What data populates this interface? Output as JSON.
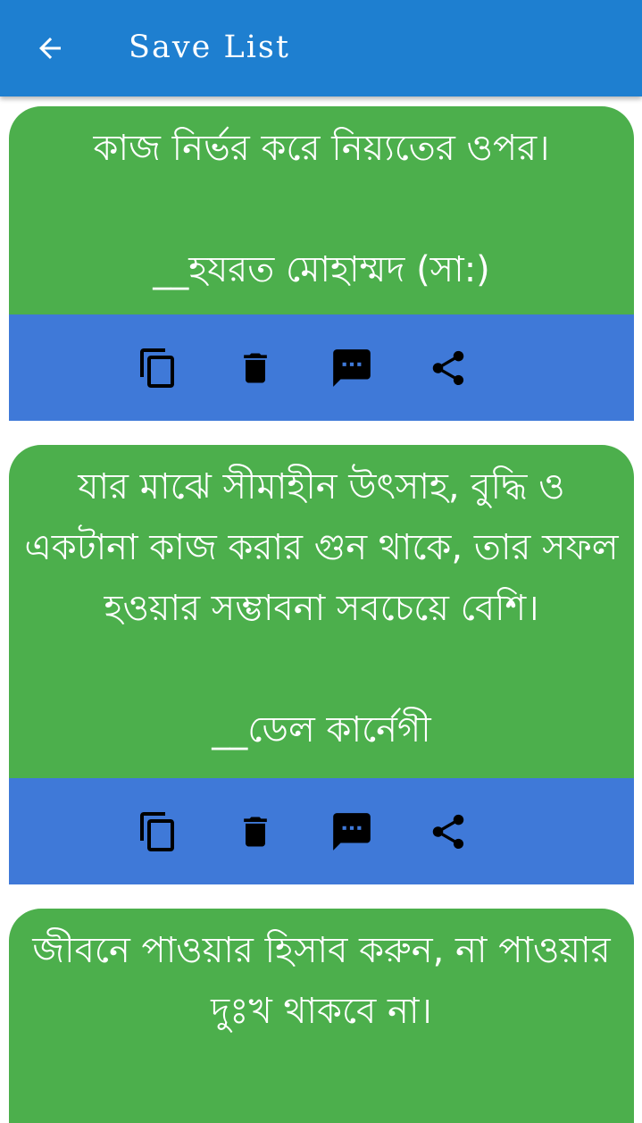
{
  "app_bar": {
    "title": "Save List",
    "back_icon": "arrow-back-icon",
    "color": "#1e7fd0"
  },
  "colors": {
    "card_background": "#4caf4c",
    "action_bar": "#3f79d8",
    "text": "#ffffff",
    "icon": "#000000"
  },
  "quotes": [
    {
      "text": "কাজ নির্ভর করে নিয়্যতের ওপর।",
      "author": "__হযরত মোহাম্মদ (সা:)"
    },
    {
      "text": "যার মাঝে সীমাহীন উৎসাহ, বুদ্ধি ও একটানা কাজ করার গুন থাকে, তার সফল হওয়ার সম্ভাবনা সবচেয়ে বেশি।",
      "author": "__ডেল কার্নেগী"
    },
    {
      "text": "জীবনে পাওয়ার হিসাব করুন, না পাওয়ার দুঃখ থাকবে না।",
      "author": ""
    }
  ],
  "action_icons": [
    "copy-icon",
    "delete-icon",
    "message-icon",
    "share-icon"
  ]
}
